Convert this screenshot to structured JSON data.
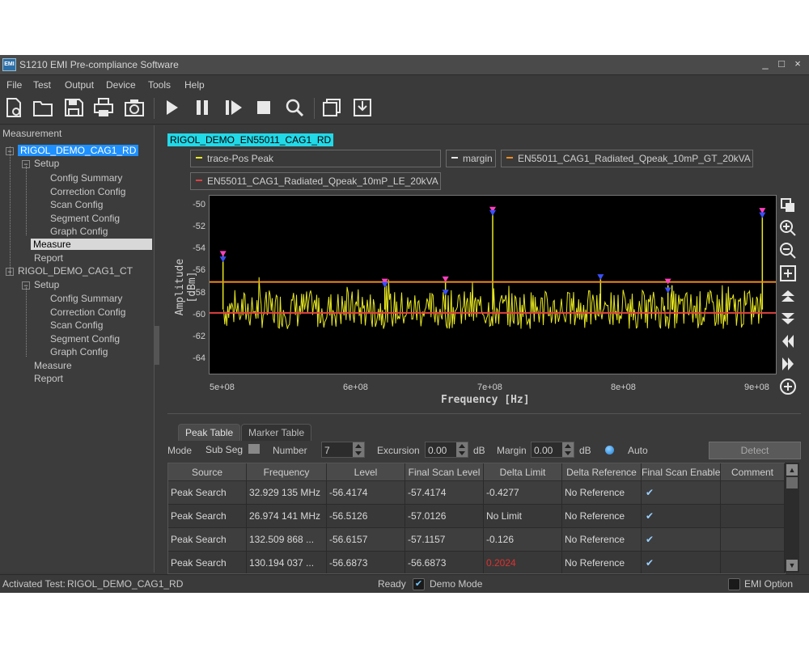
{
  "window": {
    "app_icon_text": "EMI",
    "title": "S1210 EMI Pre-compliance Software",
    "buttons": {
      "minimize": "_",
      "maximize": "□",
      "close": "×"
    }
  },
  "menu": [
    "File",
    "Test",
    "Output",
    "Device",
    "Tools",
    "Help"
  ],
  "toolbar": [
    "new-file-icon",
    "open-folder-icon",
    "save-icon",
    "print-icon",
    "camera-icon",
    "play-icon",
    "pause-icon",
    "step-icon",
    "stop-icon",
    "search-icon",
    "window-icon",
    "export-icon"
  ],
  "left_panel": {
    "header": "Measurement",
    "tree": [
      {
        "label": "RIGOL_DEMO_CAG1_RD",
        "expander": "−"
      },
      {
        "label": "Setup",
        "expander": "−"
      },
      {
        "label": "Config Summary"
      },
      {
        "label": "Correction Config"
      },
      {
        "label": "Scan Config"
      },
      {
        "label": "Segment Config"
      },
      {
        "label": "Graph Config"
      },
      {
        "label": "Measure"
      },
      {
        "label": "Report"
      },
      {
        "label": "RIGOL_DEMO_CAG1_CT",
        "expander": "−"
      },
      {
        "label": "Setup",
        "expander": "−"
      },
      {
        "label": "Config Summary"
      },
      {
        "label": "Correction Config"
      },
      {
        "label": "Scan Config"
      },
      {
        "label": "Segment Config"
      },
      {
        "label": "Graph Config"
      },
      {
        "label": "Measure"
      },
      {
        "label": "Report"
      }
    ]
  },
  "graph": {
    "test_tag": "RIGOL_DEMO_EN55011_CAG1_RD",
    "legend": [
      {
        "label": "trace-Pos Peak",
        "color": "#e8e820"
      },
      {
        "label": "margin",
        "color": "#e8e8e8"
      },
      {
        "label": "EN55011_CAG1_Radiated_Qpeak_10mP_GT_20kVA",
        "color": "#f08c1e"
      },
      {
        "label": "EN55011_CAG1_Radiated_Qpeak_10mP_LE_20kVA",
        "color": "#e04040"
      }
    ],
    "side_tools": [
      "layers-icon",
      "zoom-in-icon",
      "zoom-out-icon",
      "fit-icon",
      "scroll-up-icon",
      "scroll-down-icon",
      "scroll-left-icon",
      "scroll-right-icon",
      "add-icon"
    ]
  },
  "chart_data": {
    "type": "line",
    "xlabel": "Frequency [Hz]",
    "ylabel": "Amplitude [dBm]",
    "xlim": [
      490000000,
      910000000
    ],
    "ylim": [
      -65.3,
      -49.2
    ],
    "x_ticks": [
      {
        "value": 500000000,
        "label": "5e+08"
      },
      {
        "value": 600000000,
        "label": "6e+08"
      },
      {
        "value": 700000000,
        "label": "7e+08"
      },
      {
        "value": 800000000,
        "label": "8e+08"
      },
      {
        "value": 900000000,
        "label": "9e+08"
      }
    ],
    "y_ticks": [
      -50,
      -52,
      -54,
      -56,
      -58,
      -60,
      -62,
      -64
    ],
    "limit_lines": [
      {
        "name": "EN55011_CAG1_Radiated_Qpeak_10mP_GT_20kVA",
        "y": -57,
        "color": "#f08c1e"
      },
      {
        "name": "EN55011_CAG1_Radiated_Qpeak_10mP_LE_20kVA",
        "y": -59.8,
        "color": "#e04040"
      }
    ],
    "series": [
      {
        "name": "trace-Pos Peak",
        "color": "#e8e820",
        "noise_floor": -59.5,
        "noise_span": 3.5,
        "peaks": [
          {
            "x": 500000000,
            "y": -54.5
          },
          {
            "x": 620000000,
            "y": -57.0
          },
          {
            "x": 665000000,
            "y": -56.8
          },
          {
            "x": 700000000,
            "y": -50.5
          },
          {
            "x": 780000000,
            "y": -56.6
          },
          {
            "x": 830000000,
            "y": -57.3
          },
          {
            "x": 833000000,
            "y": -57.3
          },
          {
            "x": 900000000,
            "y": -50.6
          }
        ]
      }
    ],
    "markers": [
      {
        "x": 500000000,
        "y": -54.5,
        "color": "#ff40c0"
      },
      {
        "x": 500000000,
        "y": -55.0,
        "color": "#3a50ff"
      },
      {
        "x": 620000000,
        "y": -57.0,
        "color": "#ff40c0"
      },
      {
        "x": 620000000,
        "y": -57.3,
        "color": "#3a50ff"
      },
      {
        "x": 665000000,
        "y": -56.8,
        "color": "#ff40c0"
      },
      {
        "x": 665000000,
        "y": -58.0,
        "color": "#3a50ff"
      },
      {
        "x": 700000000,
        "y": -50.5,
        "color": "#ff40c0"
      },
      {
        "x": 700000000,
        "y": -50.8,
        "color": "#3a50ff"
      },
      {
        "x": 780000000,
        "y": -56.6,
        "color": "#3a50ff"
      },
      {
        "x": 830000000,
        "y": -57.0,
        "color": "#ff40c0"
      },
      {
        "x": 830000000,
        "y": -57.8,
        "color": "#3a50ff"
      },
      {
        "x": 900000000,
        "y": -50.6,
        "color": "#ff40c0"
      },
      {
        "x": 900000000,
        "y": -51.0,
        "color": "#3a50ff"
      }
    ]
  },
  "peak_panel": {
    "tabs": [
      "Peak Table",
      "Marker Table"
    ],
    "mode_label": "Mode",
    "mode_value": "Sub Seg",
    "number_label": "Number",
    "number_value": "7",
    "excursion_label": "Excursion",
    "excursion_value": "0.00",
    "excursion_unit": "dB",
    "margin_label": "Margin",
    "margin_value": "0.00",
    "margin_unit": "dB",
    "auto_label": "Auto",
    "detect_label": "Detect"
  },
  "table": {
    "columns": [
      "Source",
      "Frequency",
      "Level",
      "Final Scan Level",
      "Delta Limit",
      "Delta Reference",
      "Final Scan Enable",
      "Comment"
    ],
    "rows": [
      {
        "source": "Peak Search",
        "frequency": "32.929 135 MHz",
        "level": "-56.4174",
        "final_scan_level": "-57.4174",
        "delta_limit": "-0.4277",
        "delta_reference": "No Reference",
        "enable": "✔",
        "comment": ""
      },
      {
        "source": "Peak Search",
        "frequency": "26.974 141 MHz",
        "level": "-56.5126",
        "final_scan_level": "-57.0126",
        "delta_limit": "No Limit",
        "delta_reference": "No Reference",
        "enable": "✔",
        "comment": ""
      },
      {
        "source": "Peak Search",
        "frequency": "132.509 868 ...",
        "level": "-56.6157",
        "final_scan_level": "-57.1157",
        "delta_limit": "-0.126",
        "delta_reference": "No Reference",
        "enable": "✔",
        "comment": ""
      },
      {
        "source": "Peak Search",
        "frequency": "130.194 037 ...",
        "level": "-56.6873",
        "final_scan_level": "-56.6873",
        "delta_limit": "0.2024",
        "delta_reference": "No Reference",
        "enable": "✔",
        "comment": ""
      }
    ]
  },
  "status": {
    "activated_label": "Activated Test:",
    "activated_value": "RIGOL_DEMO_CAG1_RD",
    "ready": "Ready",
    "demo_mode": "Demo Mode",
    "emi_option": "EMI Option"
  },
  "colors": {
    "accent": "#1e90ff",
    "tag": "#22d9e8",
    "plot_bg": "#000000",
    "over_limit": "#e03030"
  }
}
